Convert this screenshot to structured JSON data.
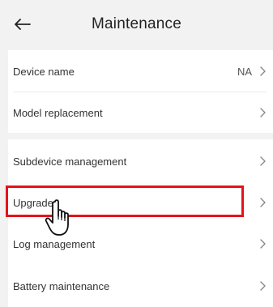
{
  "header": {
    "title": "Maintenance",
    "back_icon": "arrow-left-icon"
  },
  "settings": {
    "group1": [
      {
        "label": "Device name",
        "value": "NA"
      },
      {
        "label": "Model replacement",
        "value": ""
      }
    ],
    "group2": [
      {
        "label": "Subdevice management"
      },
      {
        "label": "Upgrade"
      },
      {
        "label": "Log management"
      },
      {
        "label": "Battery maintenance"
      }
    ]
  },
  "colors": {
    "highlight": "#e3141a",
    "background": "#f2f2f3"
  },
  "icons": {
    "row_chevron": "chevron-right-icon",
    "pointer": "hand-pointer-icon"
  }
}
